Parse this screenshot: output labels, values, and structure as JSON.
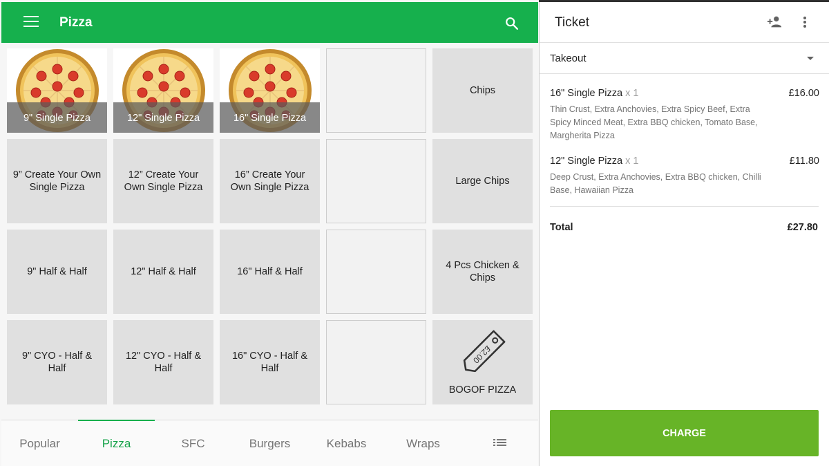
{
  "header": {
    "title": "Pizza",
    "menu_icon": "menu-icon",
    "search_icon": "search-icon"
  },
  "colors": {
    "primary": "#16b04d",
    "charge": "#67b427",
    "tile": "#e0e0e0",
    "pizza_crust": "#d9a441",
    "pizza_pepperoni": "#d93b2b"
  },
  "grid": {
    "pizza_tiles": [
      {
        "label": "9\" Single Pizza"
      },
      {
        "label": "12\" Single Pizza"
      },
      {
        "label": "16\" Single Pizza"
      }
    ],
    "chips": "Chips",
    "create_own": [
      "9” Create Your Own Single Pizza",
      "12” Create Your Own Single Pizza",
      "16” Create Your Own Single Pizza"
    ],
    "large_chips": "Large Chips",
    "half_half": [
      "9\" Half & Half",
      "12\" Half & Half",
      "16\" Half & Half"
    ],
    "chicken_chips": "4 Pcs Chicken & Chips",
    "cyo_half": [
      "9\" CYO - Half & Half",
      "12\" CYO - Half & Half",
      "16\" CYO - Half & Half"
    ],
    "bogof": {
      "label": "BOGOF PIZZA",
      "tag_text": "£2.00",
      "icon": "price-tag-icon"
    }
  },
  "tabs": [
    {
      "label": "Popular",
      "active": false
    },
    {
      "label": "Pizza",
      "active": true
    },
    {
      "label": "SFC",
      "active": false
    },
    {
      "label": "Burgers",
      "active": false
    },
    {
      "label": "Kebabs",
      "active": false
    },
    {
      "label": "Wraps",
      "active": false
    }
  ],
  "tabs_more_icon": "list-icon",
  "ticket": {
    "title": "Ticket",
    "add_customer_icon": "add-person-icon",
    "more_icon": "more-vert-icon",
    "dining_option": "Takeout",
    "items": [
      {
        "name": "16\" Single Pizza",
        "qty": "x 1",
        "price": "£16.00",
        "modifiers": "Thin Crust, Extra Anchovies, Extra Spicy Beef, Extra Spicy Minced Meat, Extra BBQ chicken, Tomato Base, Margherita Pizza"
      },
      {
        "name": "12\" Single Pizza",
        "qty": "x 1",
        "price": "£11.80",
        "modifiers": "Deep Crust, Extra Anchovies, Extra BBQ chicken, Chilli Base, Hawaiian Pizza"
      }
    ],
    "total_label": "Total",
    "total_value": "£27.80",
    "charge_label": "CHARGE"
  }
}
